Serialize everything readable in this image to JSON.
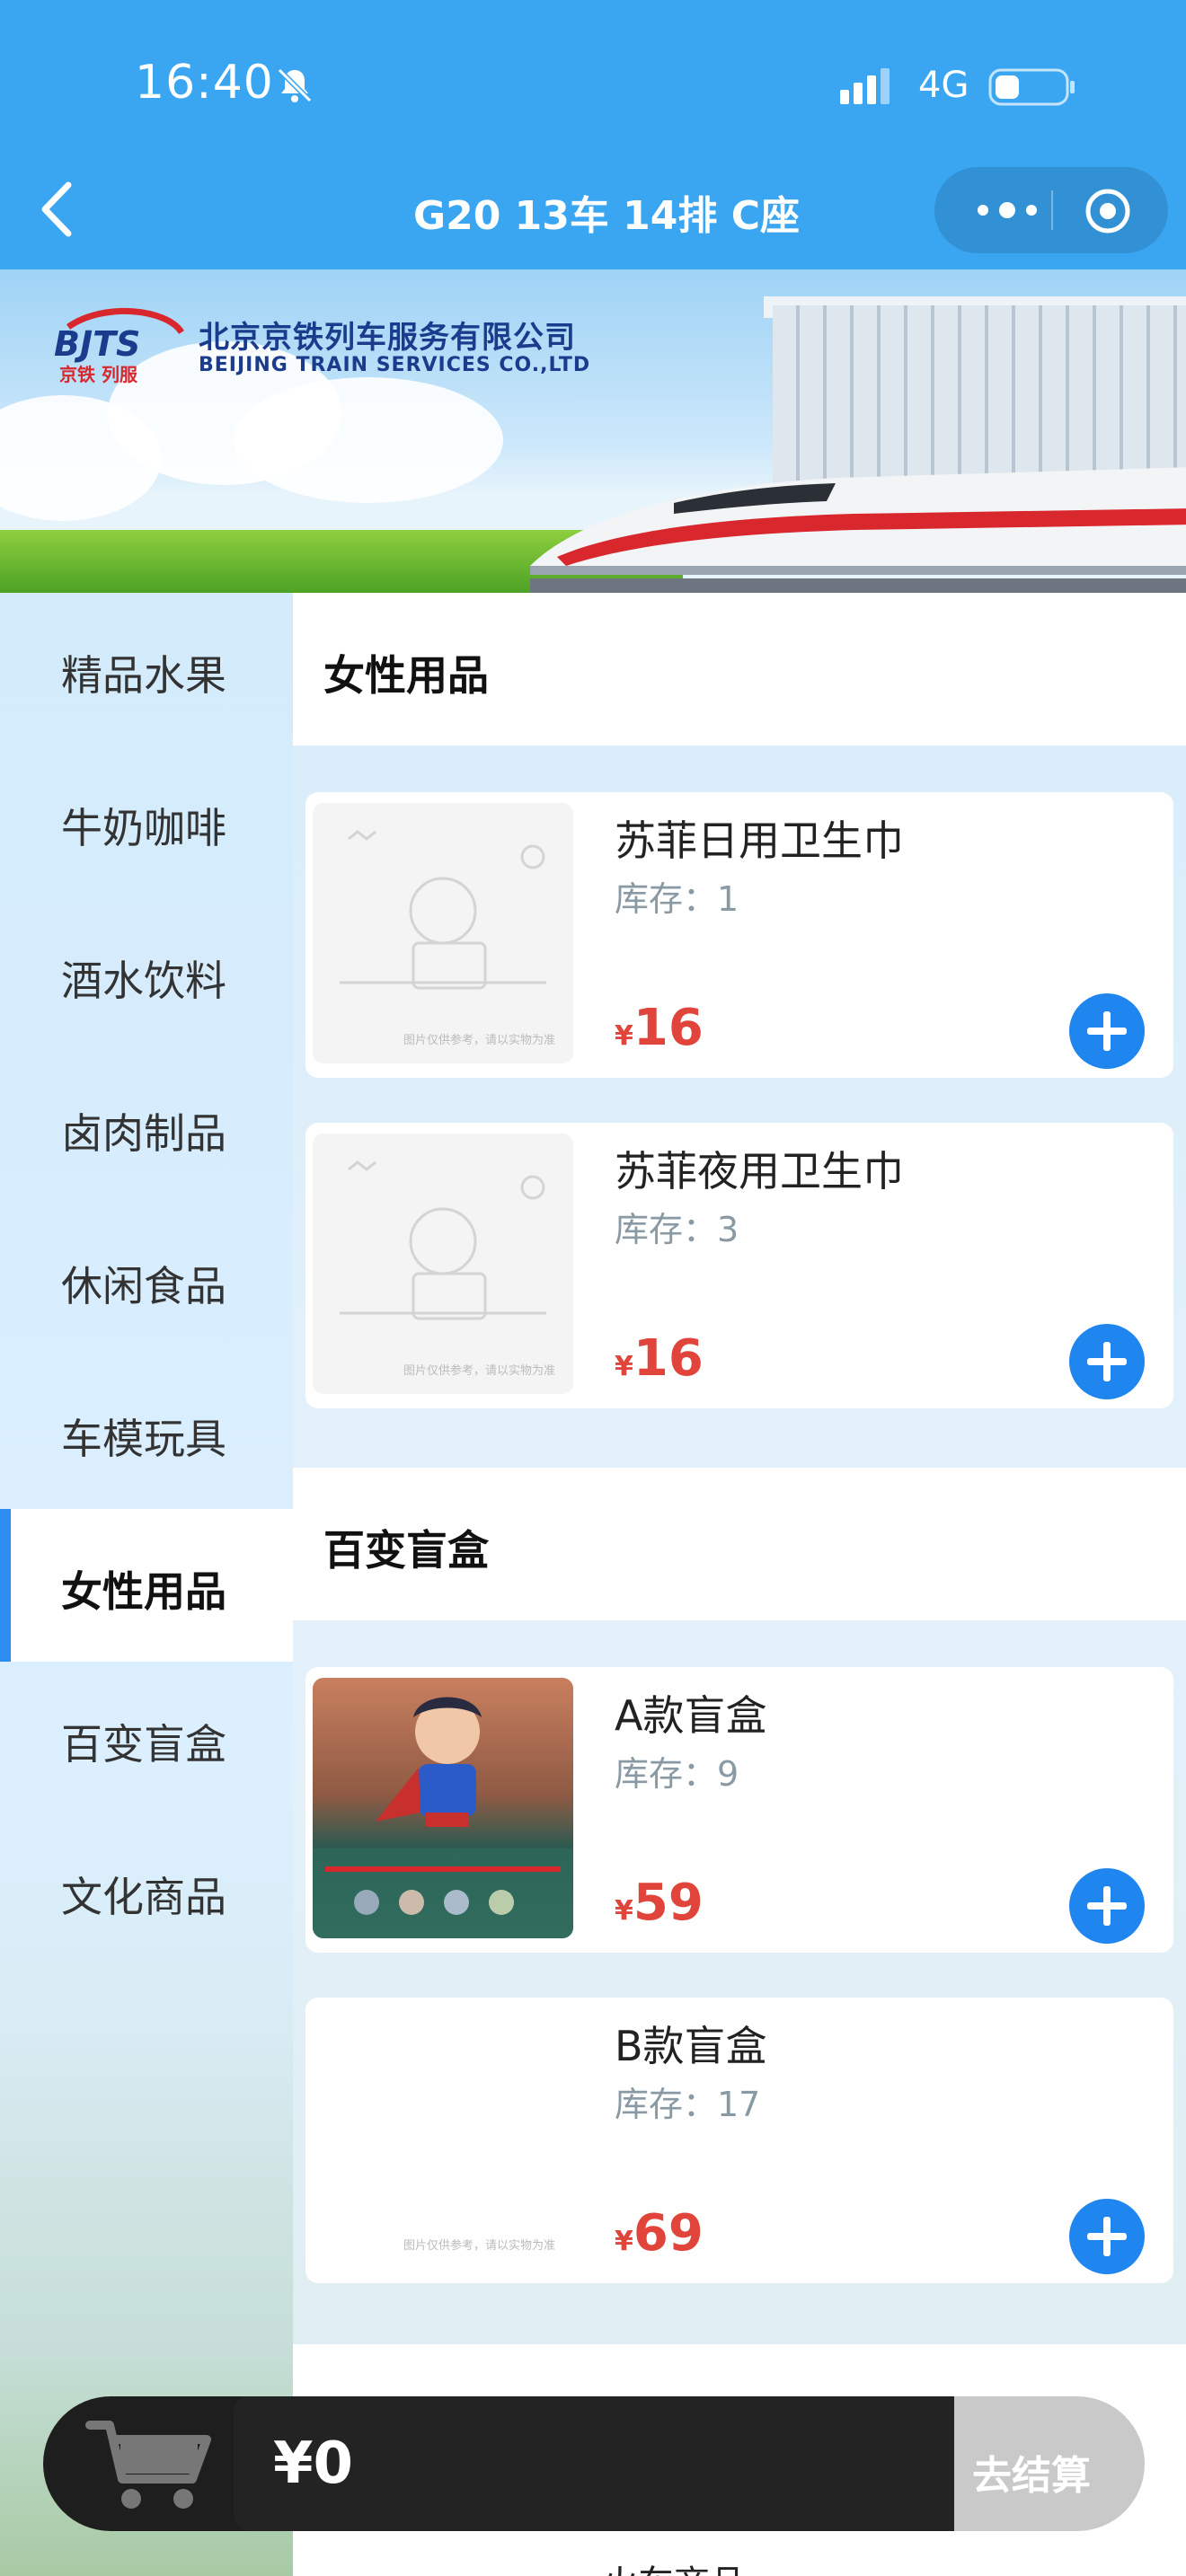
{
  "status_bar": {
    "time": "16:40",
    "network": "4G"
  },
  "nav": {
    "title": "G20 13车 14排 C座"
  },
  "banner": {
    "company_cn": "北京京铁列车服务有限公司",
    "company_en": "BEIJING TRAIN SERVICES CO.,LTD"
  },
  "sidebar": {
    "items": [
      {
        "label": "精品水果"
      },
      {
        "label": "牛奶咖啡"
      },
      {
        "label": "酒水饮料"
      },
      {
        "label": "卤肉制品"
      },
      {
        "label": "休闲食品"
      },
      {
        "label": "车模玩具"
      },
      {
        "label": "女性用品",
        "active": true
      },
      {
        "label": "百变盲盒"
      },
      {
        "label": "文化商品"
      }
    ]
  },
  "sections": [
    {
      "title": "女性用品",
      "products": [
        {
          "name": "苏菲日用卫生巾",
          "stock": "库存：1",
          "currency": "¥",
          "price": "16",
          "image_note": "图片仅供参考，请以实物为准"
        },
        {
          "name": "苏菲夜用卫生巾",
          "stock": "库存：3",
          "currency": "¥",
          "price": "16",
          "image_note": "图片仅供参考，请以实物为准"
        }
      ]
    },
    {
      "title": "百变盲盒",
      "products": [
        {
          "name": "A款盲盒",
          "stock": "库存：9",
          "currency": "¥",
          "price": "59"
        },
        {
          "name": "B款盲盒",
          "stock": "库存：17",
          "currency": "¥",
          "price": "69",
          "image_note": "图片仅供参考，请以实物为准"
        }
      ]
    }
  ],
  "next_item_partial": "火车商品",
  "cart": {
    "total": "¥0",
    "checkout_label": "去结算"
  },
  "colors": {
    "nav_bg": "#3aa6f2",
    "accent": "#1f86f0",
    "price": "#e0443a",
    "cart_bg": "#1e1e1e",
    "checkout_disabled": "#c9c9c9"
  }
}
